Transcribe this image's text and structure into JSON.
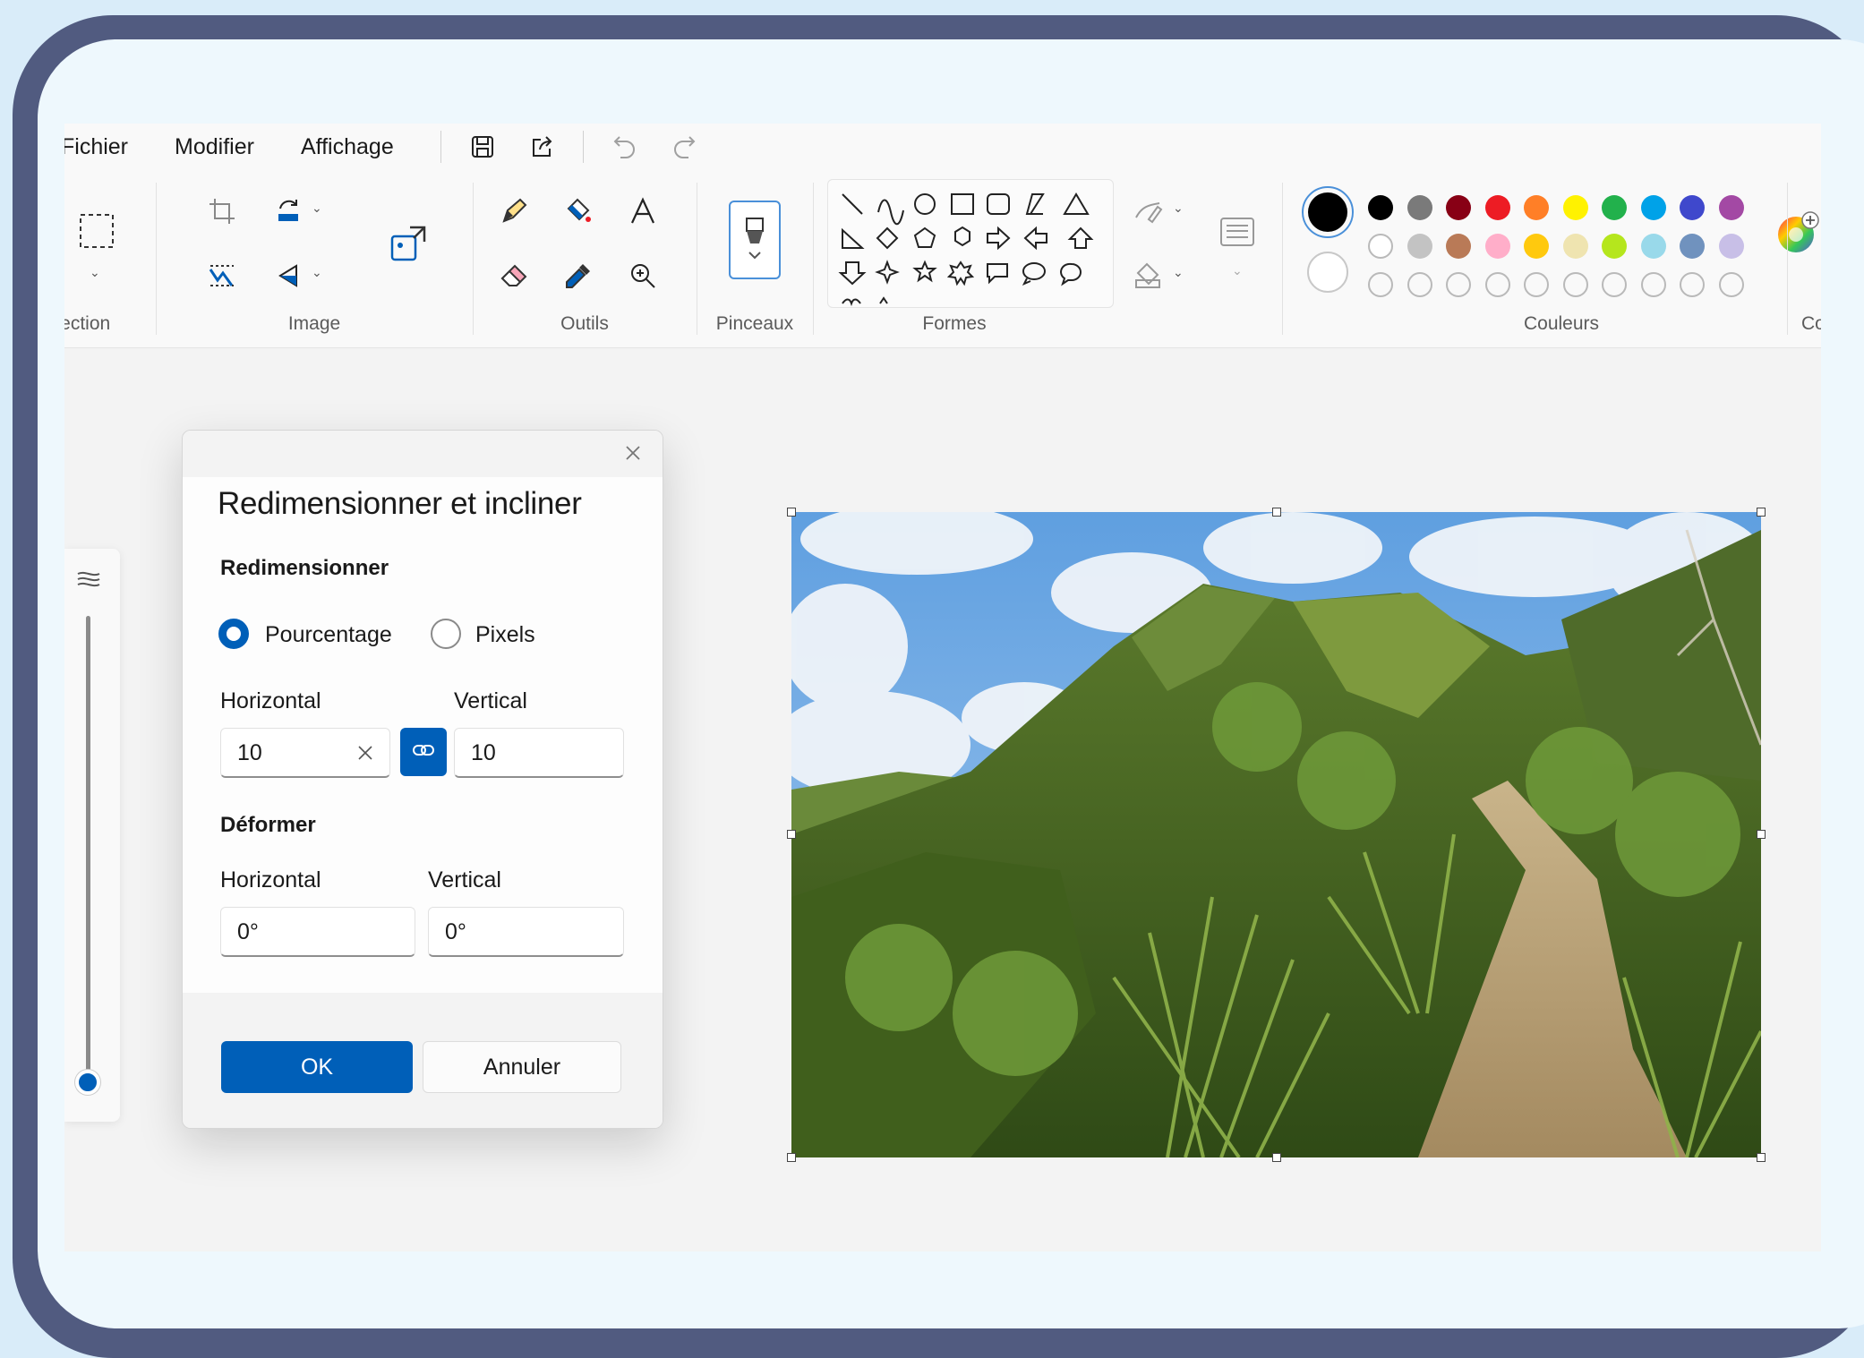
{
  "menu": {
    "items": [
      "Fichier",
      "Modifier",
      "Affichage"
    ],
    "quick_access": [
      "save-icon",
      "share-icon",
      "undo-icon",
      "redo-icon"
    ]
  },
  "ribbon": {
    "groups": {
      "selection": "Sélection",
      "image": "Image",
      "tools": "Outils",
      "brushes": "Pinceaux",
      "shapes": "Formes",
      "colors": "Couleurs",
      "next": "Co"
    },
    "color_rows": [
      [
        "#000000",
        "#7a7a7a",
        "#880015",
        "#ed1c24",
        "#ff7f27",
        "#fff200",
        "#22b14c",
        "#00a2e8",
        "#3f48cc",
        "#a349a4"
      ],
      [
        "#ffffff",
        "#c3c3c3",
        "#b97a57",
        "#ffaec9",
        "#ffc90e",
        "#efe4b0",
        "#b5e61d",
        "#99d9ea",
        "#7092be",
        "#c8bfe7"
      ],
      [
        "",
        "",
        "",
        "",
        "",
        "",
        "",
        "",
        "",
        ""
      ]
    ],
    "primary_color": "#000000",
    "secondary_color": "#ffffff"
  },
  "dialog": {
    "title": "Redimensionner et incliner",
    "resize_section": "Redimensionner",
    "option_percent": "Pourcentage",
    "option_pixels": "Pixels",
    "selected_option": "Pourcentage",
    "resize_horizontal_label": "Horizontal",
    "resize_vertical_label": "Vertical",
    "resize_horizontal_value": "10",
    "resize_vertical_value": "10",
    "skew_section": "Déformer",
    "skew_horizontal_label": "Horizontal",
    "skew_vertical_label": "Vertical",
    "skew_horizontal_value": "0°",
    "skew_vertical_value": "0°",
    "ok_label": "OK",
    "cancel_label": "Annuler"
  },
  "accent_color": "#005fb8",
  "zoom_level_fraction": 0.02
}
